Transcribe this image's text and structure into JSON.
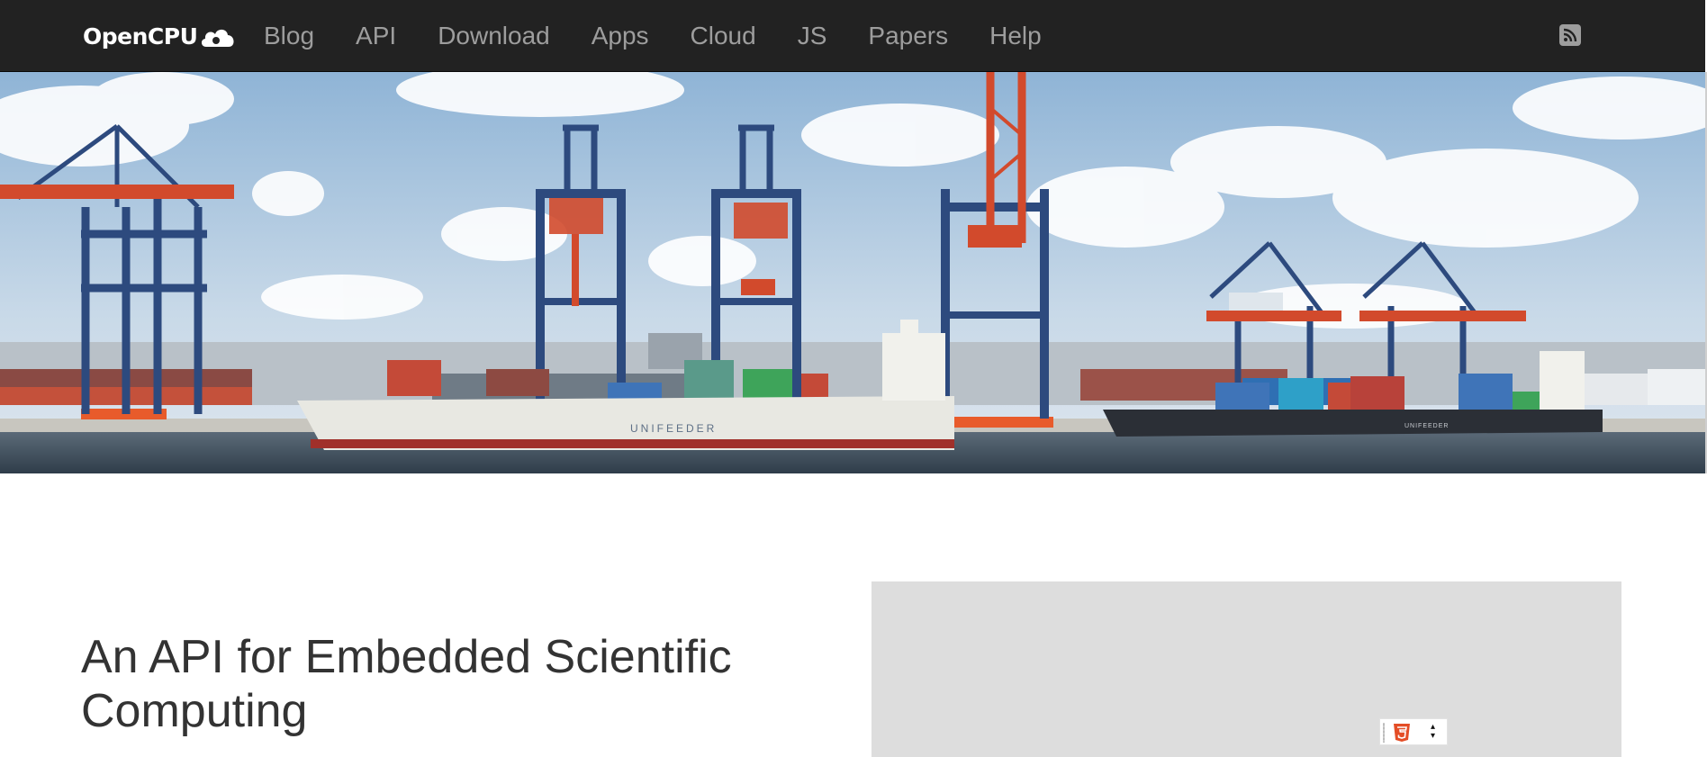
{
  "brand": {
    "name": "OpenCPU"
  },
  "nav": {
    "items": [
      {
        "label": "Blog"
      },
      {
        "label": "API"
      },
      {
        "label": "Download"
      },
      {
        "label": "Apps"
      },
      {
        "label": "Cloud"
      },
      {
        "label": "JS"
      },
      {
        "label": "Papers"
      },
      {
        "label": "Help"
      }
    ]
  },
  "hero": {
    "ship_left_name": "UNIFEEDER",
    "ship_right_name": "UNIFEEDER"
  },
  "main": {
    "headline": "An API for Embedded Scientific Computing"
  },
  "icons": {
    "rss": "rss-icon",
    "cloud": "cloud-icon",
    "widget_logo": "html5-icon",
    "widget_caret": "updown-caret-icon"
  },
  "colors": {
    "navbar_bg": "#222222",
    "nav_text": "#9d9d9d",
    "brand_text": "#ffffff",
    "headline": "#333333",
    "panel_bg": "#dddddd",
    "crane_blue": "#2d4a7e",
    "crane_red": "#d24a2c"
  }
}
